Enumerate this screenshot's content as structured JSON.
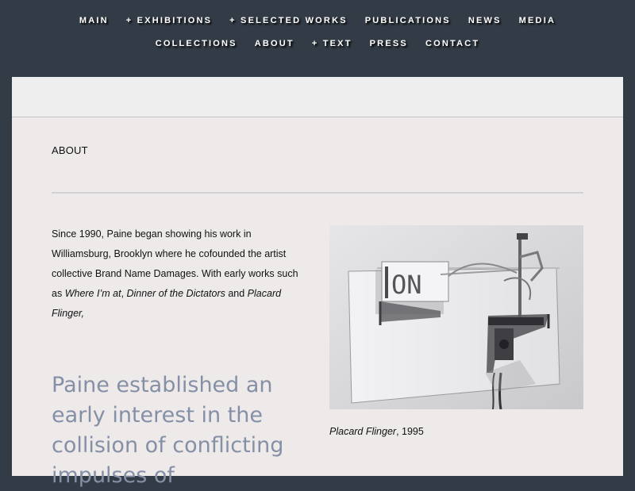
{
  "nav": {
    "row1": [
      "MAIN",
      "+ EXHIBITIONS",
      "+ SELECTED WORKS",
      "PUBLICATIONS",
      "NEWS",
      "MEDIA"
    ],
    "row2": [
      "COLLECTIONS",
      "ABOUT",
      "+ TEXT",
      "PRESS",
      "CONTACT"
    ]
  },
  "page": {
    "title": "ABOUT"
  },
  "intro": {
    "text_1": "Since 1990, Paine began showing his work in Williamsburg, Brooklyn where he cofounded the artist collective Brand Name Damages. With early works such as ",
    "work_1": "Where I’m at",
    "sep_1": ", ",
    "work_2": "Dinner of the Dictators",
    "sep_2": " and ",
    "work_3": "Placard Flinger,"
  },
  "quote": {
    "text": "Paine established an early interest in the collision of conflicting impulses of"
  },
  "artwork": {
    "sign_text": "ON",
    "caption_title": "Placard Flinger",
    "caption_year": ", 1995"
  },
  "colors": {
    "nav_background": "#333c46",
    "panel_background": "#eeeaea",
    "quote_color": "#8590a6"
  }
}
